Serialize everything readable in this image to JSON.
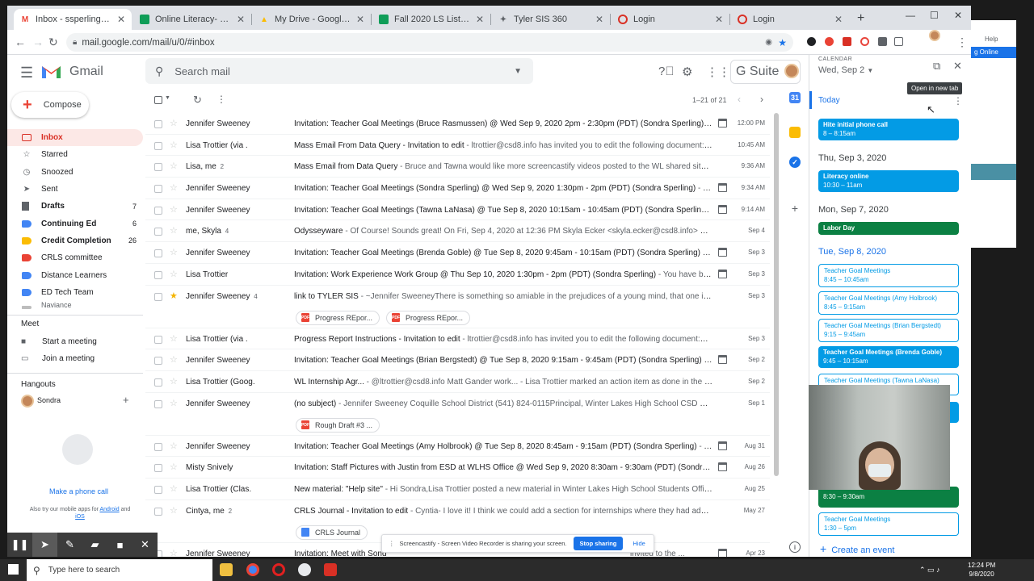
{
  "browser": {
    "tabs": [
      {
        "label": "Inbox - ssperling@csd8.info",
        "icon": "gmail-icon",
        "color": "#ea4335"
      },
      {
        "label": "Online Literacy- Mrs. Sperling",
        "icon": "classroom-icon",
        "color": "#0f9d58"
      },
      {
        "label": "My Drive - Google Drive",
        "icon": "drive-icon",
        "color": "#fbbc04"
      },
      {
        "label": "Fall 2020 LS List Sperling - Go",
        "icon": "sheets-icon",
        "color": "#0f9d58"
      },
      {
        "label": "Tyler SIS 360",
        "icon": "tyler-icon",
        "color": "#5f6368"
      },
      {
        "label": "Login",
        "icon": "login-icon",
        "color": "#d93025"
      },
      {
        "label": "Login",
        "icon": "login-icon",
        "color": "#d93025"
      }
    ],
    "url": "mail.google.com/mail/u/0/#inbox"
  },
  "gmail": {
    "product": "Gmail",
    "search_placeholder": "Search mail",
    "suite": "G Suite",
    "compose": "Compose",
    "pagination": "1–21 of 21",
    "nav": [
      {
        "label": "Inbox",
        "count": "",
        "icon": "inbox-icon",
        "color": "#d93025",
        "active": true
      },
      {
        "label": "Starred",
        "count": "",
        "icon": "star-icon",
        "color": "#5f6368"
      },
      {
        "label": "Snoozed",
        "count": "",
        "icon": "clock-icon",
        "color": "#5f6368"
      },
      {
        "label": "Sent",
        "count": "",
        "icon": "send-icon",
        "color": "#5f6368"
      },
      {
        "label": "Drafts",
        "count": "7",
        "icon": "draft-icon",
        "color": "#5f6368",
        "bold": true
      },
      {
        "label": "Continuing Ed",
        "count": "6",
        "icon": "label-icon",
        "color": "#4285f4",
        "bold": true
      },
      {
        "label": "Credit Completion",
        "count": "26",
        "icon": "label-icon",
        "color": "#fbbc04",
        "bold": true
      },
      {
        "label": "CRLS committee",
        "count": "",
        "icon": "label-icon",
        "color": "#ea4335"
      },
      {
        "label": "Distance Learners",
        "count": "",
        "icon": "label-icon",
        "color": "#4285f4"
      },
      {
        "label": "ED Tech Team",
        "count": "",
        "icon": "label-icon",
        "color": "#4285f4"
      },
      {
        "label": "Naviance",
        "count": "",
        "icon": "label-icon",
        "color": "#bdbdbd"
      }
    ],
    "meet": {
      "heading": "Meet",
      "start": "Start a meeting",
      "join": "Join a meeting"
    },
    "hangouts": {
      "heading": "Hangouts",
      "user": "Sondra",
      "make_call": "Make a phone call",
      "mobile_pre": "Also try our mobile apps for",
      "android": "Android",
      "and": "and",
      "ios": "iOS"
    },
    "emails": [
      {
        "from": "Jennifer Sweeney",
        "n": "",
        "subject": "Invitation: Teacher Goal Meetings (Bruce Rasmussen) @ Wed Sep 9, 2020 2pm - 2:30pm (PDT) (Sondra Sperling)",
        "snippet": " - You h...",
        "date": "12:00 PM",
        "cal": true,
        "starred": false
      },
      {
        "from": "Lisa Trottier (via .",
        "n": "",
        "subject": "Mass Email From Data Query - Invitation to edit",
        "snippet": " - ltrottier@csd8.info has invited you to edit the following document: Ma...",
        "date": "10:45 AM",
        "cal": false,
        "starred": false
      },
      {
        "from": "Lisa, me",
        "n": "2",
        "subject": "Mass Email from Data Query",
        "snippet": " - Bruce and Tawna would like more screencastify videos posted to the WL shared site if yo...",
        "date": "9:36 AM",
        "cal": false,
        "starred": false
      },
      {
        "from": "Jennifer Sweeney",
        "n": "",
        "subject": "Invitation: Teacher Goal Meetings (Sondra Sperling) @ Wed Sep 9, 2020 1:30pm - 2pm (PDT) (Sondra Sperling)",
        "snippet": " - You ha...",
        "date": "9:34 AM",
        "cal": true,
        "starred": false
      },
      {
        "from": "Jennifer Sweeney",
        "n": "",
        "subject": "Invitation: Teacher Goal Meetings (Tawna LaNasa) @ Tue Sep 8, 2020 10:15am - 10:45am (PDT) (Sondra Sperling)",
        "snippet": " - You ...",
        "date": "9:14 AM",
        "cal": true,
        "starred": false
      },
      {
        "from": "me, Skyla",
        "n": "4",
        "subject": "Odysseyware",
        "snippet": " - Of Course! Sounds great! On Fri, Sep 4, 2020 at 12:36 PM Skyla Ecker <skyla.ecker@csd8.info> wrote: Hi ...",
        "date": "Sep 4",
        "cal": false,
        "starred": false
      },
      {
        "from": "Jennifer Sweeney",
        "n": "",
        "subject": "Invitation: Teacher Goal Meetings (Brenda Goble) @ Tue Sep 8, 2020 9:45am - 10:15am (PDT) (Sondra Sperling)",
        "snippet": " - You ha...",
        "date": "Sep 3",
        "cal": true,
        "starred": false
      },
      {
        "from": "Lisa Trottier",
        "n": "",
        "subject": "Invitation: Work Experience Work Group @ Thu Sep 10, 2020 1:30pm - 2pm (PDT) (Sondra Sperling)",
        "snippet": " - You have been invit...",
        "date": "Sep 3",
        "cal": true,
        "starred": false
      },
      {
        "from": "Jennifer Sweeney",
        "n": "4",
        "subject": "link to TYLER SIS",
        "snippet": " - ~Jennifer SweeneyThere is something so amiable in the prejudices of a young mind, that one is sorry...",
        "date": "Sep 3",
        "cal": false,
        "starred": true,
        "attachments": [
          {
            "label": "Progress REpor...",
            "type": "pdf"
          },
          {
            "label": "Progress REpor...",
            "type": "pdf"
          }
        ]
      },
      {
        "from": "Lisa Trottier (via .",
        "n": "",
        "subject": "Progress Report Instructions - Invitation to edit",
        "snippet": " - ltrottier@csd8.info has invited you to edit the following document:Prog...",
        "date": "Sep 3",
        "cal": false,
        "starred": false
      },
      {
        "from": "Jennifer Sweeney",
        "n": "",
        "subject": "Invitation: Teacher Goal Meetings (Brian Bergstedt) @ Tue Sep 8, 2020 9:15am - 9:45am (PDT) (Sondra Sperling)",
        "snippet": " - You ha...",
        "date": "Sep 2",
        "cal": true,
        "starred": false
      },
      {
        "from": "Lisa Trottier (Goog.",
        "n": "",
        "subject": "WL Internship Agr...",
        "snippet": " - @ltrottier@csd8.info Matt Gander work... - Lisa Trottier marked an action item as done in the follo...",
        "date": "Sep 2",
        "cal": false,
        "starred": false
      },
      {
        "from": "Jennifer Sweeney",
        "n": "",
        "subject": "(no subject)",
        "snippet": " - Jennifer Sweeney Coquille School District (541) 824-0115Principal, Winter Lakes High School CSD Curricu...",
        "date": "Sep 1",
        "cal": false,
        "starred": false,
        "attachments": [
          {
            "label": "Rough Draft #3 ...",
            "type": "pdf"
          }
        ]
      },
      {
        "from": "Jennifer Sweeney",
        "n": "",
        "subject": "Invitation: Teacher Goal Meetings (Amy Holbrook) @ Tue Sep 8, 2020 8:45am - 9:15am (PDT) (Sondra Sperling)",
        "snippet": " - You ha...",
        "date": "Aug 31",
        "cal": true,
        "starred": false
      },
      {
        "from": "Misty Snively",
        "n": "",
        "subject": "Invitation: Staff Pictures with Justin from ESD at WLHS Office @ Wed Sep 9, 2020 8:30am - 9:30am (PDT) (Sondra Sperli...",
        "snippet": "",
        "date": "Aug 26",
        "cal": true,
        "starred": false
      },
      {
        "from": "Lisa Trottier (Clas.",
        "n": "",
        "subject": "New material: \"Help site\"",
        "snippet": " - Hi Sondra,Lisa Trottier posted a new material in Winter Lakes High School Students Office of ...",
        "date": "Aug 25",
        "cal": false,
        "starred": false
      },
      {
        "from": "Cintya, me",
        "n": "2",
        "subject": "CRLS Journal - Invitation to edit",
        "snippet": " - Cyntia- I love it! I think we could add a section for internships where they had additiona...",
        "date": "May 27",
        "cal": false,
        "starred": false,
        "attachments": [
          {
            "label": "CRLS Journal",
            "type": "doc"
          }
        ]
      },
      {
        "from": "Jennifer Sweeney",
        "n": "",
        "subject": "Invitation: Meet with Sond",
        "snippet": "",
        "date": "Apr 23",
        "cal": true,
        "starred": false,
        "tail": "invited to the ..."
      }
    ]
  },
  "calendar": {
    "heading": "CALENDAR",
    "date": "Wed, Sep 2",
    "tooltip": "Open in new tab",
    "today": "Today",
    "days": [
      {
        "label": "Thu, Sep 3, 2020"
      },
      {
        "label": "Mon, Sep 7, 2020"
      },
      {
        "label": "Tue, Sep 8, 2020"
      }
    ],
    "events": [
      {
        "title": "Hite initial phone call",
        "time": "8 – 8:15am",
        "color": "#039be5"
      },
      {
        "title": "Literacy online",
        "time": "10:30 – 11am",
        "color": "#039be5"
      },
      {
        "title": "Labor Day",
        "time": "",
        "color": "#0b8043"
      },
      {
        "title": "Teacher Goal Meetings",
        "time": "8:45 – 10:45am",
        "color": "#039be5"
      },
      {
        "title": "Teacher Goal Meetings (Amy Holbrook)",
        "time": "8:45 – 9:15am",
        "color": "#039be5"
      },
      {
        "title": "Teacher Goal Meetings (Brian Bergstedt)",
        "time": "9:15 – 9:45am",
        "color": "#039be5"
      },
      {
        "title": "Teacher Goal Meetings (Brenda Goble)",
        "time": "9:45 – 10:15am",
        "color": "#039be5"
      },
      {
        "title": "Teacher Goal Meetings (Tawna LaNasa)",
        "time": "",
        "color": "#039be5"
      },
      {
        "title": "",
        "time": "8:30 – 9:30am",
        "color": "#0b8043"
      },
      {
        "title": "Teacher Goal Meetings",
        "time": "1:30 – 5pm",
        "color": "#039be5"
      }
    ],
    "create": "Create an event"
  },
  "screencastify": {
    "message": "Screencastify - Screen Video Recorder is sharing your screen.",
    "stop": "Stop sharing",
    "hide": "Hide"
  },
  "right_app": {
    "help": "Help",
    "online": "g Online"
  },
  "taskbar": {
    "search": "Type here to search",
    "time": "12:24 PM",
    "date": "9/8/2020"
  }
}
